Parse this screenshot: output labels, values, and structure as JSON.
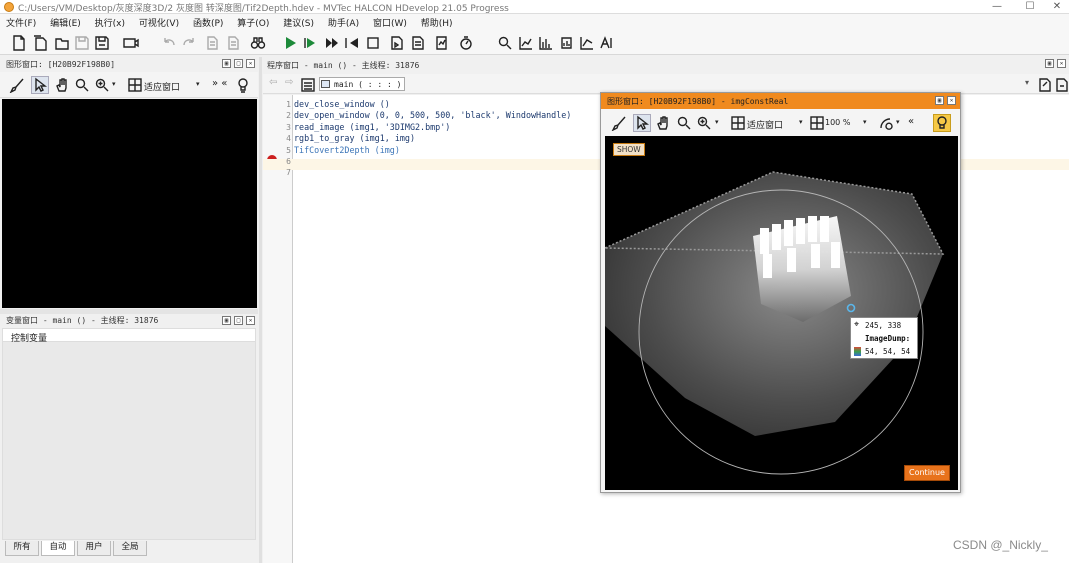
{
  "window": {
    "title": "C:/Users/VM/Desktop/灰度深度3D/2 灰度图 转深度图/Tif2Depth.hdev - MVTec HALCON HDevelop 21.05 Progress",
    "min": "—",
    "max": "☐",
    "close": "✕"
  },
  "menu": [
    "文件(F)",
    "编辑(E)",
    "执行(x)",
    "可视化(V)",
    "函数(P)",
    "算子(O)",
    "建议(S)",
    "助手(A)",
    "窗口(W)",
    "帮助(H)"
  ],
  "graphics_panel": {
    "title": "图形窗口: [H20B92F198B0]",
    "fit_label": "适应窗口"
  },
  "variables_panel": {
    "title": "变量窗口 - main () - 主线程: 31876",
    "section": "控制变量",
    "tabs": [
      "所有",
      "自动",
      "用户",
      "全局"
    ],
    "active_tab": 1
  },
  "program_panel": {
    "title": "程序窗口 - main () - 主线程: 31876",
    "procedure": "main ( : : : )",
    "lines": [
      "dev_close_window ()",
      "dev_open_window (0, 0, 500, 500, 'black', WindowHandle)",
      "",
      "read_image (img1, '3DIMG2.bmp')",
      "rgb1_to_gray (img1, img)",
      "TifCovert2Depth (img)",
      ""
    ],
    "line_numbers": [
      "1",
      "2",
      "3",
      "4",
      "5",
      "6",
      "7"
    ],
    "breakpoint_line": 6
  },
  "float_window": {
    "title": "图形窗口: [H20B92F198B0] - imgConstReal",
    "fit_label": "适应窗口",
    "zoom_label": "100 %",
    "show_label": "SHOW",
    "continue_label": "Continue",
    "tooltip": {
      "coords": "245, 338",
      "dump_label": "ImageDump:",
      "values": "54, 54, 54"
    }
  },
  "watermark": "CSDN @_Nickly_",
  "colors": {
    "accent_orange": "#f08a1e",
    "breakpoint": "#cc1f1f",
    "continue_bg": "#e8731c"
  }
}
